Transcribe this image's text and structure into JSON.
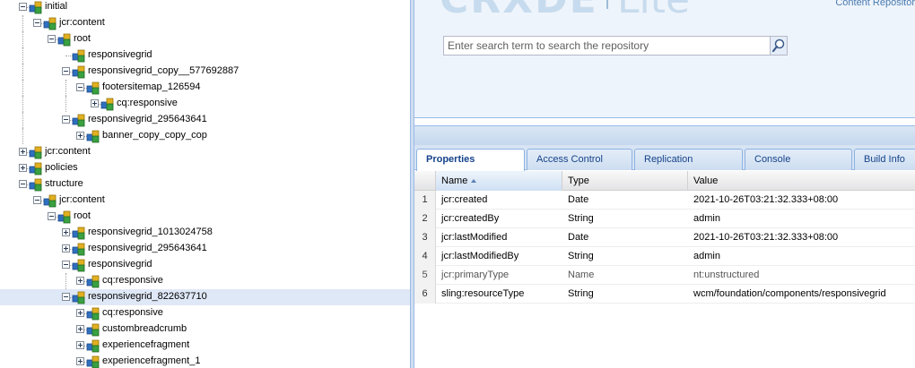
{
  "tree": {
    "nodes": [
      {
        "label": "initial",
        "depth": 2,
        "toggle": "minus",
        "selected": false
      },
      {
        "label": "jcr:content",
        "depth": 3,
        "toggle": "minus",
        "selected": false
      },
      {
        "label": "root",
        "depth": 4,
        "toggle": "minus",
        "selected": false
      },
      {
        "label": "responsivegrid",
        "depth": 5,
        "toggle": "none",
        "selected": false
      },
      {
        "label": "responsivegrid_copy__577692887",
        "depth": 5,
        "toggle": "minus",
        "selected": false
      },
      {
        "label": "footersitemap_126594",
        "depth": 6,
        "toggle": "minus",
        "selected": false
      },
      {
        "label": "cq:responsive",
        "depth": 7,
        "toggle": "plus",
        "selected": false
      },
      {
        "label": "responsivegrid_295643641",
        "depth": 5,
        "toggle": "minus",
        "selected": false
      },
      {
        "label": "banner_copy_copy_cop",
        "depth": 6,
        "toggle": "plus",
        "selected": false
      },
      {
        "label": "jcr:content",
        "depth": 2,
        "toggle": "plus",
        "selected": false
      },
      {
        "label": "policies",
        "depth": 2,
        "toggle": "plus",
        "selected": false
      },
      {
        "label": "structure",
        "depth": 2,
        "toggle": "minus",
        "selected": false
      },
      {
        "label": "jcr:content",
        "depth": 3,
        "toggle": "minus",
        "selected": false
      },
      {
        "label": "root",
        "depth": 4,
        "toggle": "minus",
        "selected": false
      },
      {
        "label": "responsivegrid_1013024758",
        "depth": 5,
        "toggle": "plus",
        "selected": false
      },
      {
        "label": "responsivegrid_295643641",
        "depth": 5,
        "toggle": "plus",
        "selected": false
      },
      {
        "label": "responsivegrid",
        "depth": 5,
        "toggle": "minus",
        "selected": false
      },
      {
        "label": "cq:responsive",
        "depth": 6,
        "toggle": "plus",
        "selected": false
      },
      {
        "label": "responsivegrid_822637710",
        "depth": 5,
        "toggle": "minus",
        "selected": true
      },
      {
        "label": "cq:responsive",
        "depth": 6,
        "toggle": "plus",
        "selected": false
      },
      {
        "label": "custombreadcrumb",
        "depth": 6,
        "toggle": "plus",
        "selected": false
      },
      {
        "label": "experiencefragment",
        "depth": 6,
        "toggle": "plus",
        "selected": false
      },
      {
        "label": "experiencefragment_1",
        "depth": 6,
        "toggle": "plus",
        "selected": false
      }
    ]
  },
  "header": {
    "logo_text": "CRXDE",
    "logo_lite": "Lite",
    "subtitle": "Content Repositor"
  },
  "search": {
    "placeholder": "Enter search term to search the repository",
    "icon": "search-icon"
  },
  "tabs": [
    {
      "label": "Properties",
      "active": true
    },
    {
      "label": "Access Control",
      "active": false
    },
    {
      "label": "Replication",
      "active": false
    },
    {
      "label": "Console",
      "active": false
    },
    {
      "label": "Build Info",
      "active": false
    }
  ],
  "grid": {
    "columns": [
      "Name",
      "Type",
      "Value"
    ],
    "sorted_column": "Name",
    "rows": [
      {
        "num": "1",
        "name": "jcr:created",
        "type": "Date",
        "value": "2021-10-26T03:21:32.333+08:00",
        "protected": false
      },
      {
        "num": "2",
        "name": "jcr:createdBy",
        "type": "String",
        "value": "admin",
        "protected": false
      },
      {
        "num": "3",
        "name": "jcr:lastModified",
        "type": "Date",
        "value": "2021-10-26T03:21:32.333+08:00",
        "protected": false
      },
      {
        "num": "4",
        "name": "jcr:lastModifiedBy",
        "type": "String",
        "value": "admin",
        "protected": false
      },
      {
        "num": "5",
        "name": "jcr:primaryType",
        "type": "Name",
        "value": "nt:unstructured",
        "protected": true
      },
      {
        "num": "6",
        "name": "sling:resourceType",
        "type": "String",
        "value": "wcm/foundation/components/responsivegrid",
        "protected": false
      }
    ]
  },
  "colors": {
    "accent": "#15428b",
    "selection": "#dfe8f6",
    "panel_border": "#99bbe8"
  }
}
